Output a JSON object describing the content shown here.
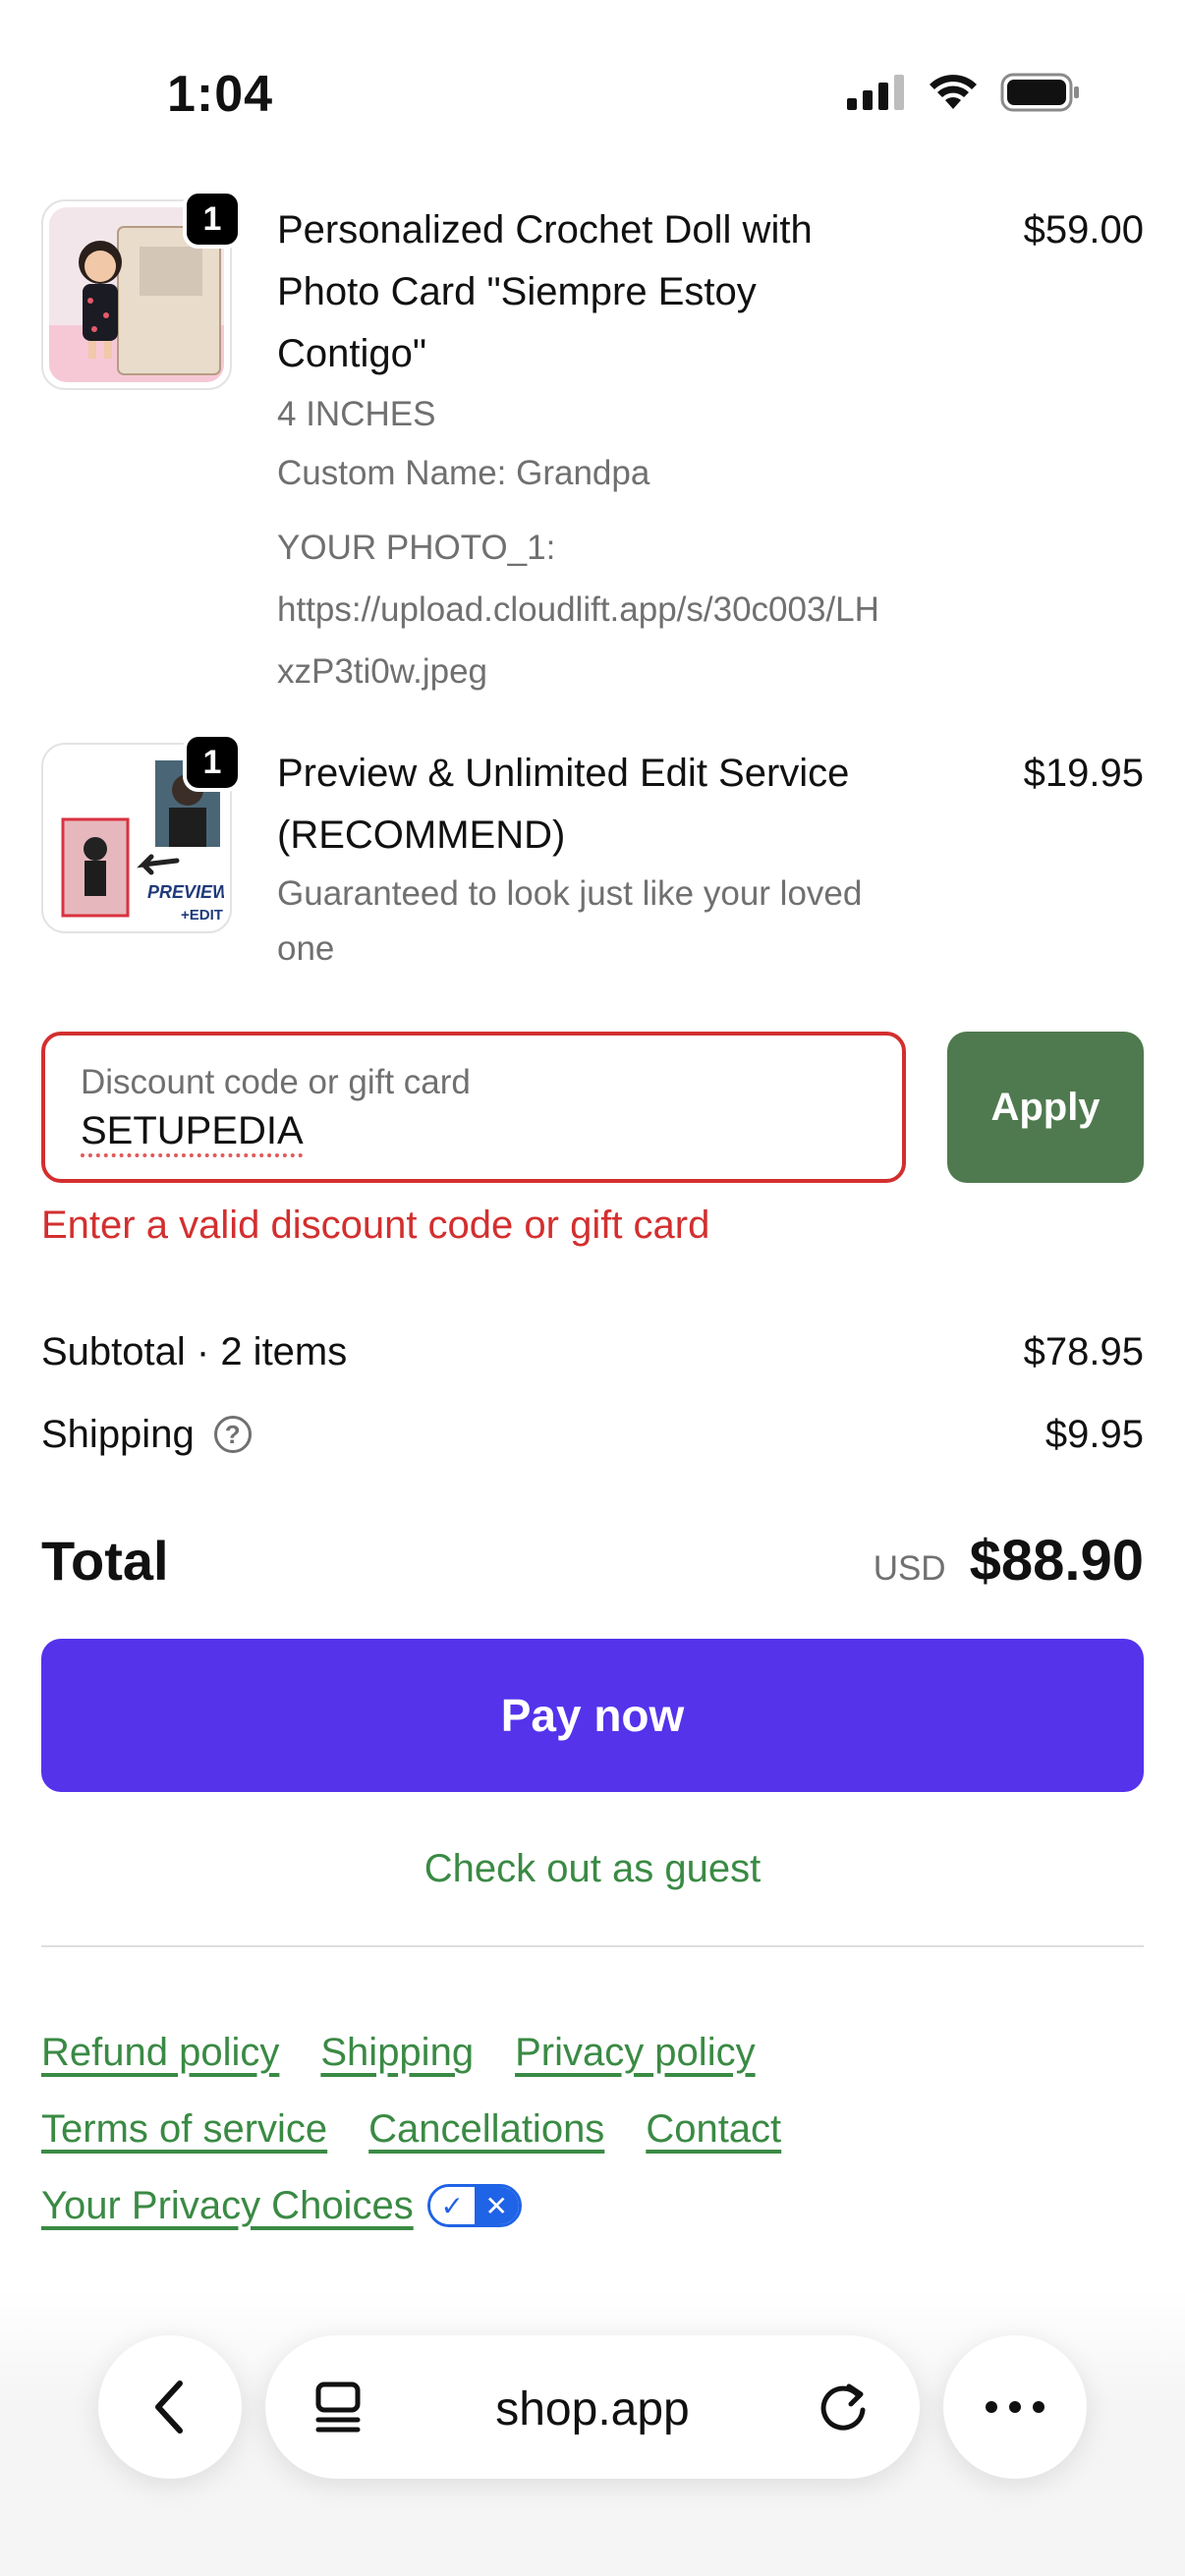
{
  "status_bar": {
    "time": "1:04"
  },
  "items": [
    {
      "qty": "1",
      "title_lines": [
        "Personalized Crochet Doll with",
        "Photo Card \"Siempre Estoy",
        "Contigo\""
      ],
      "price": "$59.00",
      "variant": "4 INCHES",
      "custom_name": "Custom Name: Grandpa",
      "photo_label": "YOUR PHOTO_1:",
      "photo_url_lines": [
        "https://upload.cloudlift.app/s/30c003/LH",
        "xzP3ti0w.jpeg"
      ]
    },
    {
      "qty": "1",
      "title_lines": [
        "Preview & Unlimited Edit Service",
        "(RECOMMEND)"
      ],
      "price": "$19.95",
      "desc_lines": [
        "Guaranteed to look just like your loved",
        "one"
      ],
      "thumb_text_preview": "PREVIEW",
      "thumb_text_edit": "+EDIT"
    }
  ],
  "discount": {
    "placeholder": "Discount code or gift card",
    "value": "SETUPEDIA",
    "apply_label": "Apply",
    "error": "Enter a valid discount code or gift card"
  },
  "summary": {
    "subtotal_label": "Subtotal · 2 items",
    "subtotal_value": "$78.95",
    "shipping_label": "Shipping",
    "shipping_value": "$9.95",
    "total_label": "Total",
    "currency": "USD",
    "total_value": "$88.90"
  },
  "actions": {
    "pay_label": "Pay now",
    "guest_label": "Check out as guest"
  },
  "footer": {
    "refund": "Refund policy",
    "shipping": "Shipping",
    "privacy": "Privacy policy",
    "terms": "Terms of service",
    "cancellations": "Cancellations",
    "contact": "Contact",
    "privacy_choices": "Your Privacy Choices"
  },
  "browser": {
    "url": "shop.app"
  },
  "colors": {
    "pay": "#5433eb",
    "apply": "#4f7a4f",
    "error": "#d32f2f",
    "link": "#3a8a44"
  }
}
